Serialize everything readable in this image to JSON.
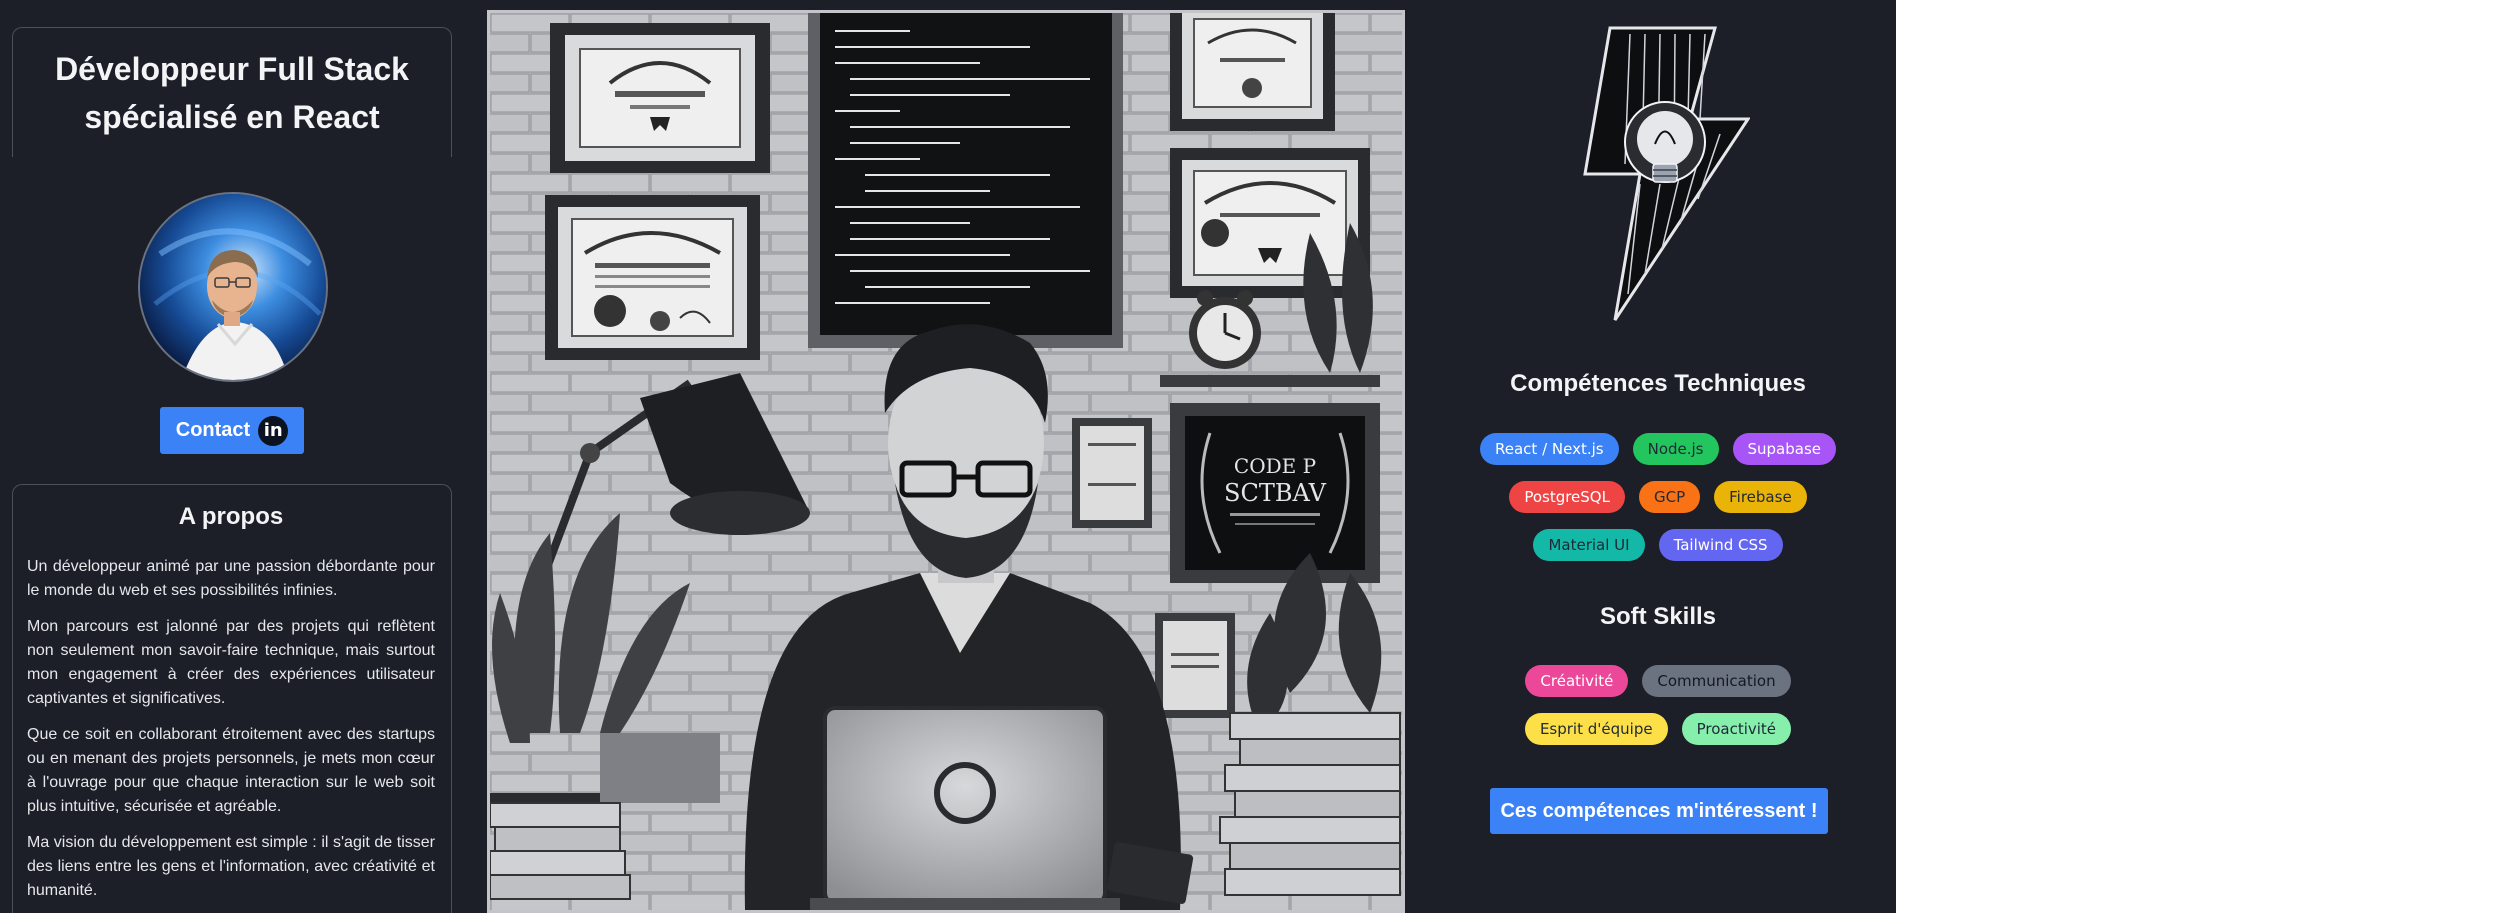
{
  "hero": {
    "title": "Développeur Full Stack spécialisé en React",
    "contact_label": "Contact",
    "contact_icon": "linkedin-icon",
    "contact_icon_text": "in"
  },
  "about": {
    "heading": "A propos",
    "paragraphs": [
      "Un développeur animé par une passion débordante pour le monde du web et ses possibilités infinies.",
      "Mon parcours est jalonné par des projets qui reflètent non seulement mon savoir-faire technique, mais surtout mon engagement à créer des expériences utilisateur captivantes et significatives.",
      "Que ce soit en collaborant étroitement avec des startups ou en menant des projets personnels, je mets mon cœur à l'ouvrage pour que chaque interaction sur le web soit plus intuitive, sécurisée et agréable.",
      "Ma vision du développement est simple : il s'agit de tisser des liens entre les gens et l'information, avec créativité et humanité."
    ]
  },
  "illustration": {
    "wall_sign_lines": [
      "CODE P",
      "SCTBAV"
    ]
  },
  "technical_skills": {
    "heading": "Compétences Techniques",
    "rows": [
      [
        {
          "label": "React / Next.js",
          "bg": "#3b82f6",
          "fg": "#ffffff"
        },
        {
          "label": "Node.js",
          "bg": "#22c55e",
          "fg": "#1f2937"
        },
        {
          "label": "Supabase",
          "bg": "#a855f7",
          "fg": "#ffffff"
        }
      ],
      [
        {
          "label": "PostgreSQL",
          "bg": "#ef4444",
          "fg": "#ffffff"
        },
        {
          "label": "GCP",
          "bg": "#f97316",
          "fg": "#1f2937"
        },
        {
          "label": "Firebase",
          "bg": "#eab308",
          "fg": "#1f2937"
        }
      ],
      [
        {
          "label": "Material UI",
          "bg": "#14b8a6",
          "fg": "#1f2937"
        },
        {
          "label": "Tailwind CSS",
          "bg": "#6366f1",
          "fg": "#ffffff"
        }
      ]
    ]
  },
  "soft_skills": {
    "heading": "Soft Skills",
    "rows": [
      [
        {
          "label": "Créativité",
          "bg": "#ec4899",
          "fg": "#ffffff"
        },
        {
          "label": "Communication",
          "bg": "#6b7280",
          "fg": "#111827"
        }
      ],
      [
        {
          "label": "Esprit d'équipe",
          "bg": "#fde047",
          "fg": "#1f2937"
        },
        {
          "label": "Proactivité",
          "bg": "#86efac",
          "fg": "#1f2937"
        }
      ]
    ]
  },
  "cta": {
    "label": "Ces compétences m'intéressent !"
  }
}
